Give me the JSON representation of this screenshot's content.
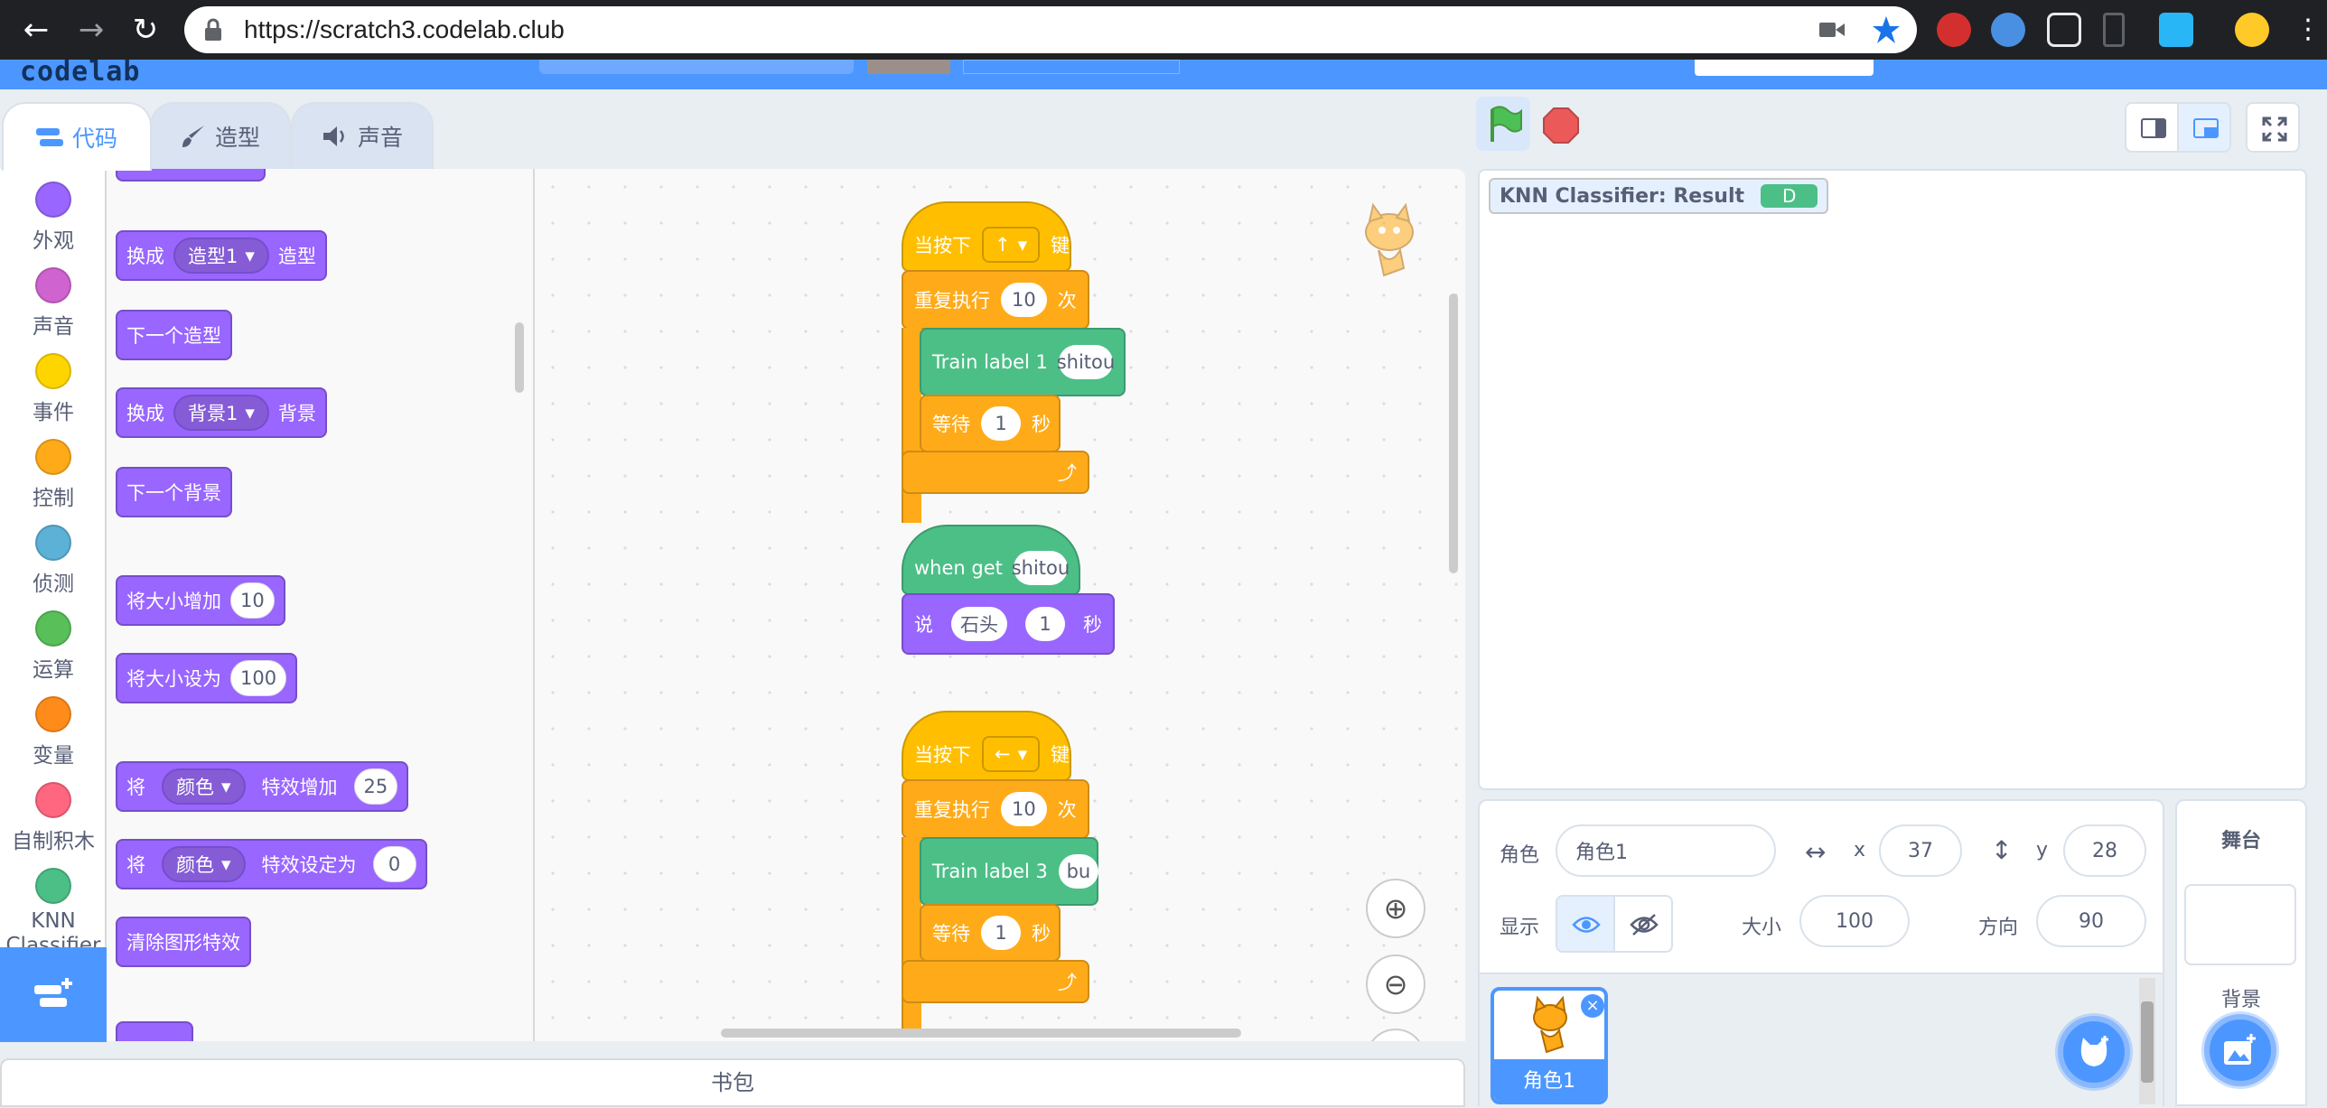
{
  "browser": {
    "url": "https://scratch3.codelab.club"
  },
  "menubar": {
    "logo": "codelab"
  },
  "tabs": [
    {
      "label": "代码",
      "icon": "code-icon",
      "active": true
    },
    {
      "label": "造型",
      "icon": "brush-icon",
      "active": false
    },
    {
      "label": "声音",
      "icon": "speaker-icon",
      "active": false
    }
  ],
  "categories": [
    {
      "label": "外观",
      "color": "#9966ff"
    },
    {
      "label": "声音",
      "color": "#cf63cf"
    },
    {
      "label": "事件",
      "color": "#ffd500"
    },
    {
      "label": "控制",
      "color": "#ffab19"
    },
    {
      "label": "侦测",
      "color": "#5cb1d6"
    },
    {
      "label": "运算",
      "color": "#59c059"
    },
    {
      "label": "变量",
      "color": "#ff8c1a"
    },
    {
      "label": "自制积木",
      "color": "#ff6680"
    },
    {
      "label": "KNN Classifier",
      "color": "#4cbf87"
    }
  ],
  "palette": {
    "switch_costume": {
      "pre": "换成",
      "dropdown": "造型1",
      "post": "造型"
    },
    "next_costume": "下一个造型",
    "switch_backdrop": {
      "pre": "换成",
      "dropdown": "背景1",
      "post": "背景"
    },
    "next_backdrop": "下一个背景",
    "change_size": {
      "label": "将大小增加",
      "value": "10"
    },
    "set_size": {
      "label": "将大小设为",
      "value": "100"
    },
    "change_effect": {
      "pre": "将",
      "dropdown": "颜色",
      "post": "特效增加",
      "value": "25"
    },
    "set_effect": {
      "pre": "将",
      "dropdown": "颜色",
      "post": "特效设定为",
      "value": "0"
    },
    "clear_effects": "清除图形特效"
  },
  "scripts": {
    "s1": {
      "hat_pre": "当按下",
      "key": "↑",
      "hat_post": "键",
      "repeat_pre": "重复执行",
      "repeat_n": "10",
      "repeat_post": "次",
      "train": "Train label 1",
      "train_val": "shitou",
      "wait_pre": "等待",
      "wait_n": "1",
      "wait_post": "秒"
    },
    "s2": {
      "hat": "when get",
      "hat_val": "shitou",
      "say": "说",
      "say_val": "石头",
      "say_n": "1",
      "say_post": "秒"
    },
    "s3": {
      "hat_pre": "当按下",
      "key": "←",
      "hat_post": "键",
      "repeat_pre": "重复执行",
      "repeat_n": "10",
      "repeat_post": "次",
      "train": "Train label 3",
      "train_val": "bu",
      "wait_pre": "等待",
      "wait_n": "1",
      "wait_post": "秒"
    }
  },
  "backpack": "书包",
  "monitor": {
    "label": "KNN Classifier: Result",
    "value": "D"
  },
  "sprite_info": {
    "sprite_label": "角色",
    "sprite_name": "角色1",
    "x_label": "x",
    "x": "37",
    "y_label": "y",
    "y": "28",
    "show_label": "显示",
    "size_label": "大小",
    "size": "100",
    "direction_label": "方向",
    "direction": "90"
  },
  "sprites": [
    {
      "name": "角色1",
      "selected": true
    }
  ],
  "stage_pane": {
    "title": "舞台",
    "backdrops_label": "背景"
  }
}
